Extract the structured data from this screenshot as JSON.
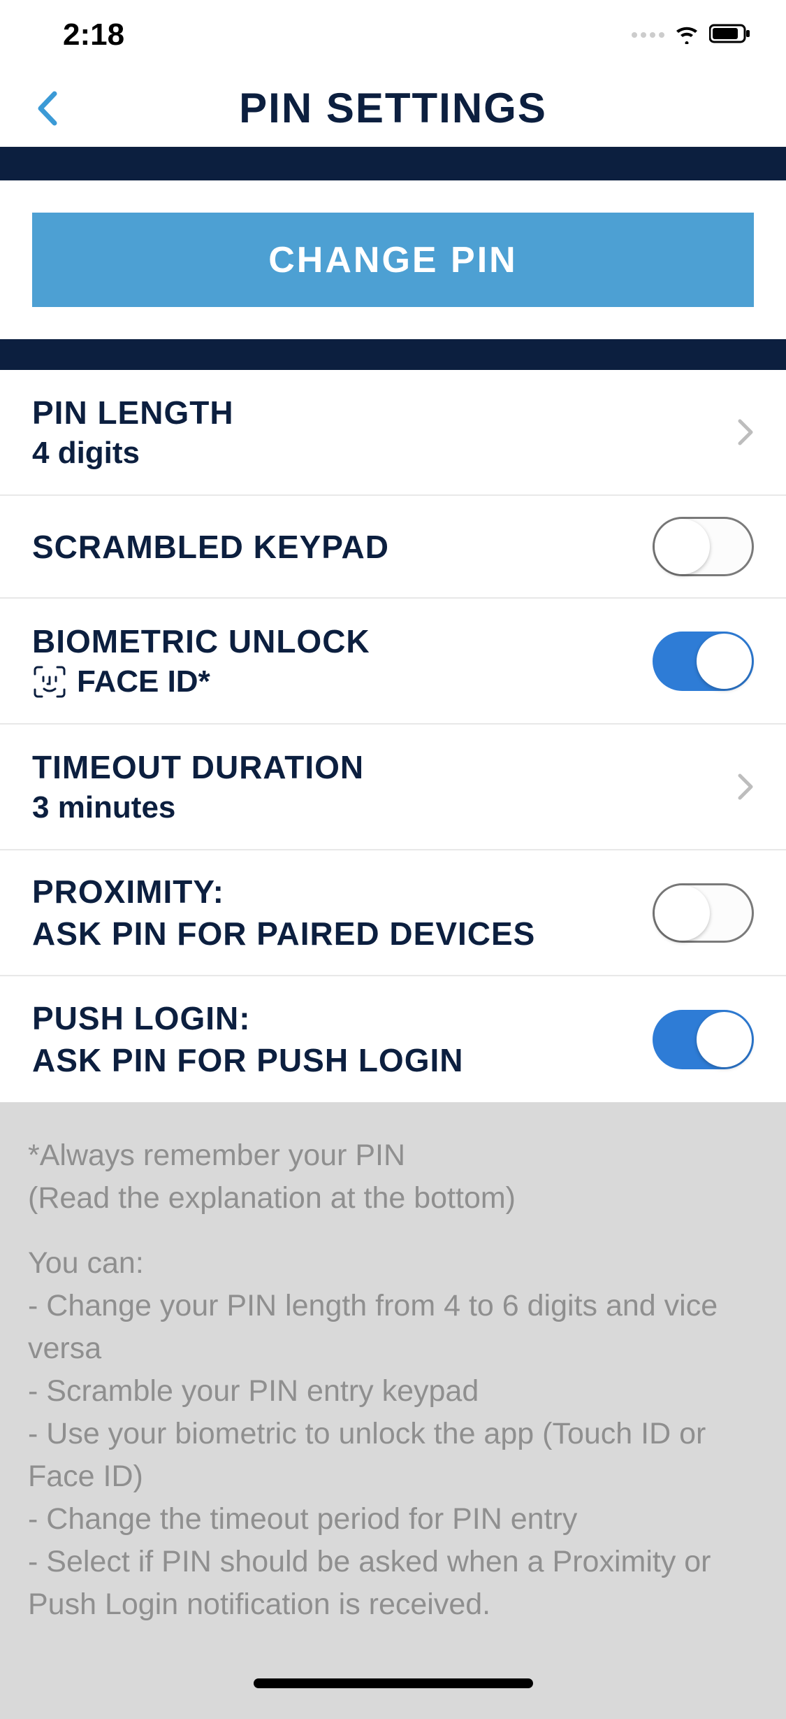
{
  "status": {
    "time": "2:18"
  },
  "header": {
    "title": "PIN SETTINGS"
  },
  "actions": {
    "change_pin": "CHANGE PIN"
  },
  "rows": {
    "pin_length": {
      "title": "PIN LENGTH",
      "value": "4 digits"
    },
    "scrambled": {
      "title": "SCRAMBLED KEYPAD"
    },
    "biometric": {
      "title": "BIOMETRIC UNLOCK",
      "sub": "FACE ID*"
    },
    "timeout": {
      "title": "TIMEOUT DURATION",
      "value": "3 minutes"
    },
    "proximity": {
      "title1": "PROXIMITY:",
      "title2": "ASK PIN FOR PAIRED DEVICES"
    },
    "push": {
      "title1": "PUSH LOGIN:",
      "title2": "ASK PIN FOR PUSH LOGIN"
    }
  },
  "toggles": {
    "scrambled": false,
    "biometric": true,
    "proximity": false,
    "push": true
  },
  "info": {
    "l1": "*Always remember your PIN",
    "l2": "(Read the explanation at the bottom)",
    "l3": "You can:",
    "l4": " - Change your PIN length from 4 to 6 digits and vice versa",
    "l5": " - Scramble your PIN entry keypad",
    "l6": " - Use your biometric to unlock the app (Touch ID or Face ID)",
    "l7": " - Change the timeout period for PIN entry",
    "l8": " - Select if PIN should be asked when a Proximity or Push Login notification is received."
  }
}
